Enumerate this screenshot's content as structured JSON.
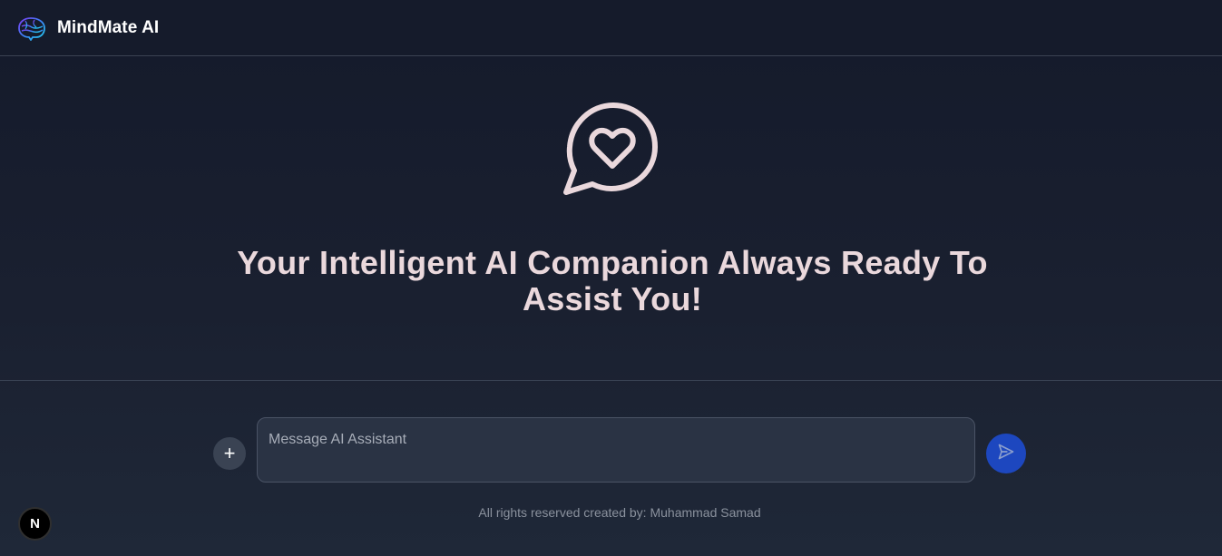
{
  "header": {
    "brand_name": "MindMate AI",
    "logo_icon": "brain-icon"
  },
  "hero": {
    "icon": "heart-chat-bubble-icon",
    "title": "Your Intelligent AI Companion Always Ready To Assist You!"
  },
  "composer": {
    "attach_icon": "plus-icon",
    "attach_label": "+",
    "placeholder": "Message AI Assistant",
    "value": "",
    "send_icon": "send-icon"
  },
  "footer": {
    "text": "All rights reserved created by: Muhammad Samad"
  },
  "dev_badge": {
    "label": "N"
  },
  "colors": {
    "accent": "#1d4ed8",
    "title_text": "#ead8dc",
    "background": "#1a2030"
  }
}
